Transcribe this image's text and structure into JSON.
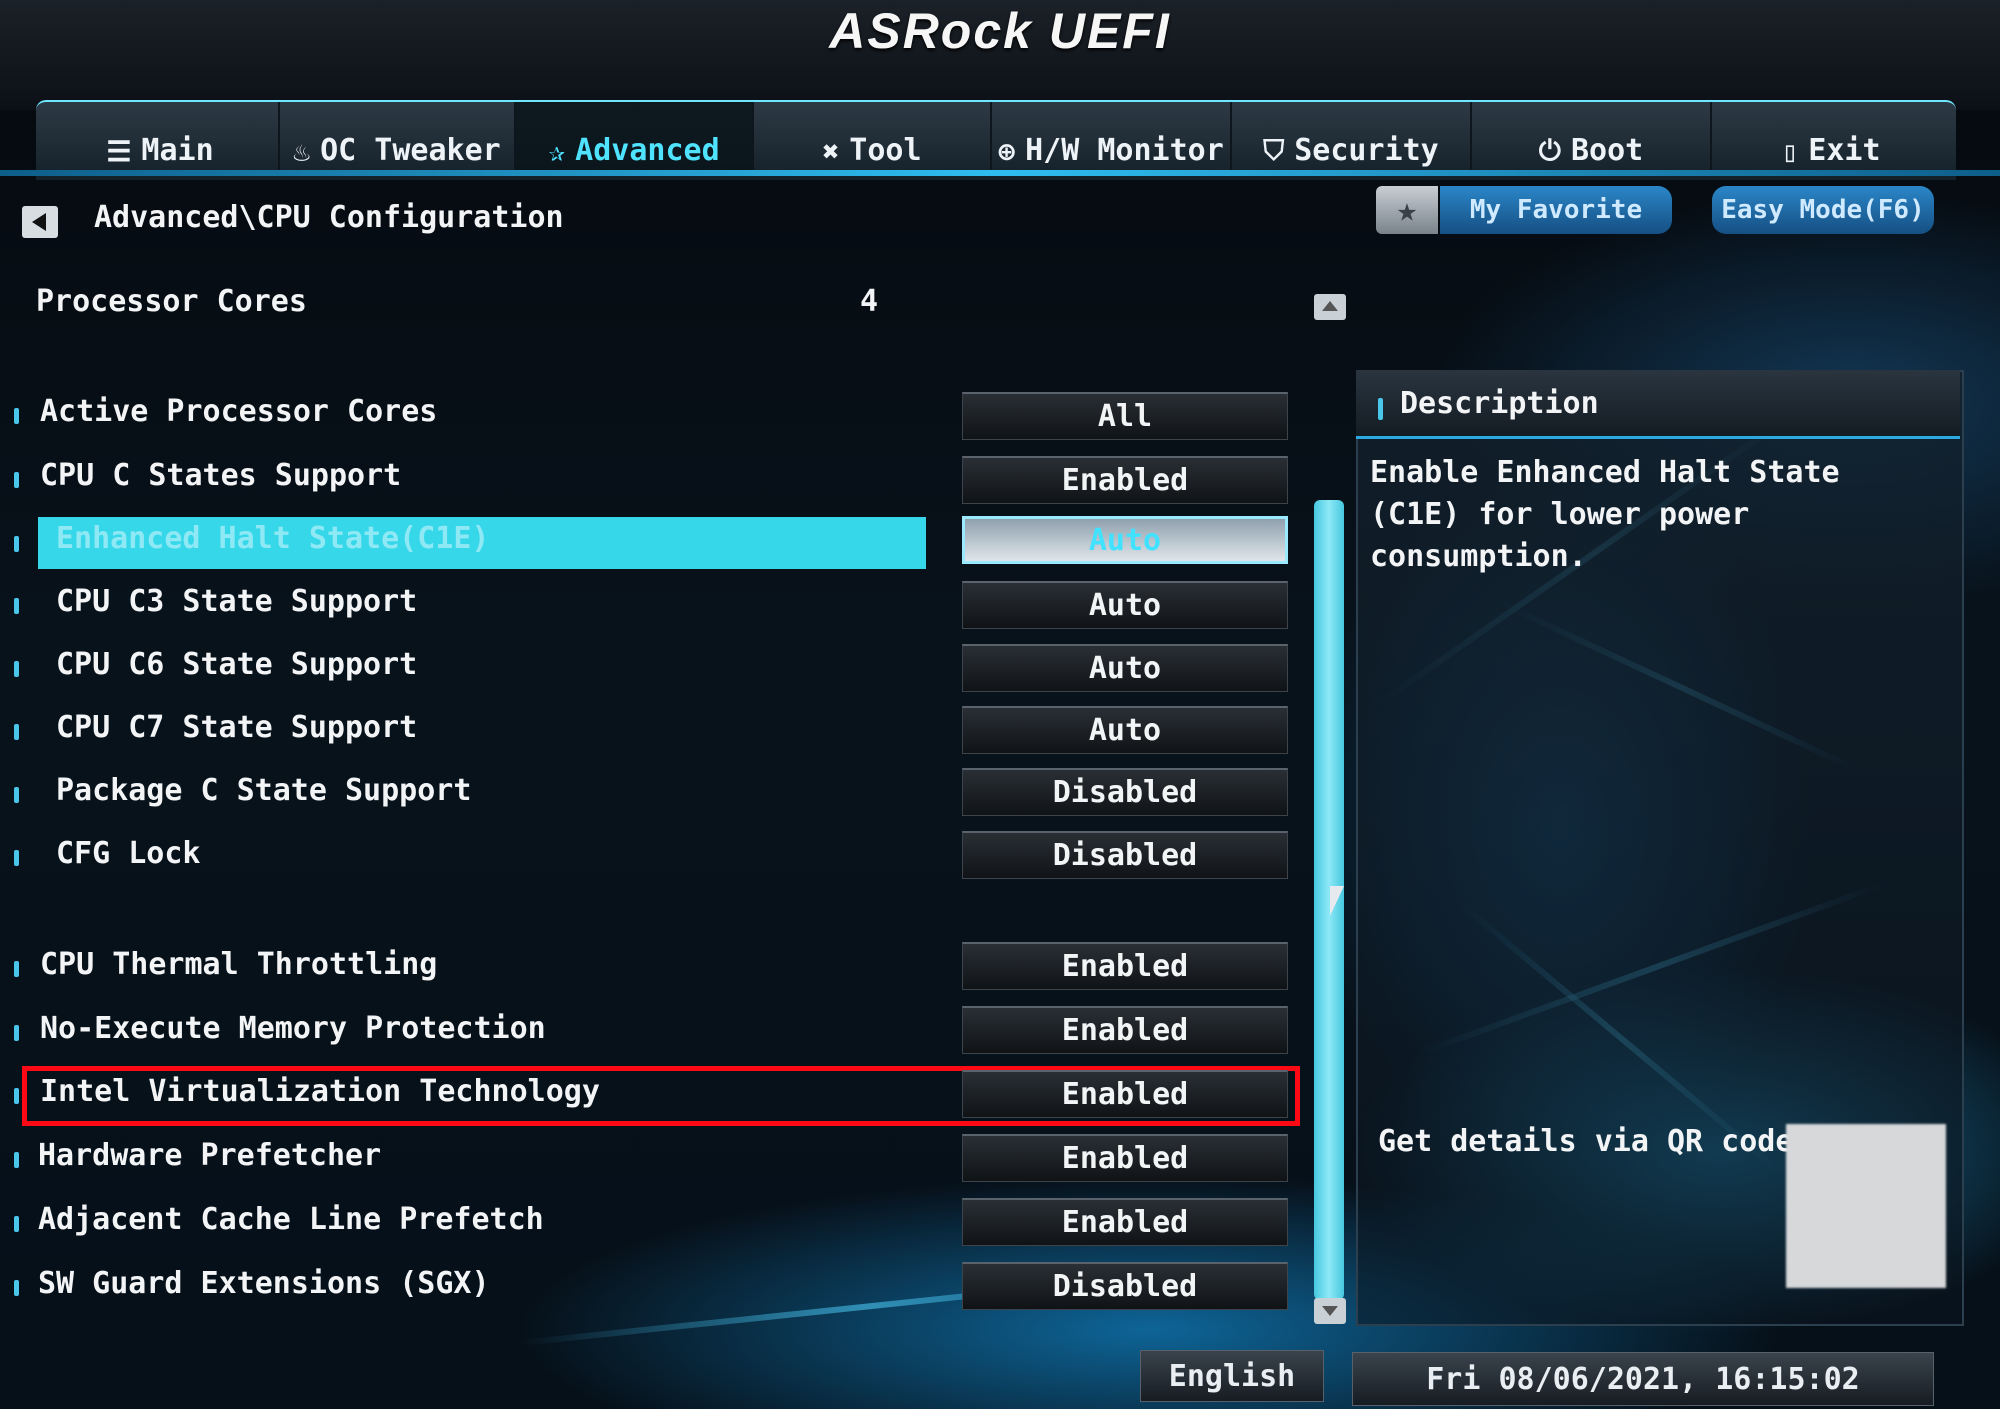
{
  "header": {
    "logo": "ASRock UEFI"
  },
  "tabs": [
    {
      "label": "Main",
      "icon": "list-icon",
      "glyph": "☰"
    },
    {
      "label": "OC Tweaker",
      "icon": "rocket-icon",
      "glyph": "♨"
    },
    {
      "label": "Advanced",
      "icon": "star-icon",
      "glyph": "✰"
    },
    {
      "label": "Tool",
      "icon": "tools-icon",
      "glyph": "✖"
    },
    {
      "label": "H/W Monitor",
      "icon": "monitor-icon",
      "glyph": "⊕"
    },
    {
      "label": "Security",
      "icon": "shield-icon",
      "glyph": "⛉"
    },
    {
      "label": "Boot",
      "icon": "power-icon",
      "glyph": "⏻"
    },
    {
      "label": "Exit",
      "icon": "exit-icon",
      "glyph": "▯"
    }
  ],
  "active_tab": "Advanced",
  "breadcrumb": "Advanced\\CPU Configuration",
  "favorites": {
    "star": "★",
    "my_favorite": "My Favorite",
    "easy_mode": "Easy Mode(F6)"
  },
  "processor_cores": {
    "label": "Processor Cores",
    "value": "4"
  },
  "settings": [
    {
      "label": "Active Processor Cores",
      "value": "All"
    },
    {
      "label": "CPU C States Support",
      "value": "Enabled"
    },
    {
      "label": "Enhanced Halt State(C1E)",
      "value": "Auto",
      "selected": true
    },
    {
      "label": "CPU C3 State Support",
      "value": "Auto"
    },
    {
      "label": "CPU C6 State Support",
      "value": "Auto"
    },
    {
      "label": "CPU C7 State Support",
      "value": "Auto"
    },
    {
      "label": "Package C State Support",
      "value": "Disabled"
    },
    {
      "label": "CFG Lock",
      "value": "Disabled"
    },
    {
      "label": "CPU Thermal Throttling",
      "value": "Enabled"
    },
    {
      "label": "No-Execute Memory Protection",
      "value": "Enabled"
    },
    {
      "label": "Intel Virtualization Technology",
      "value": "Enabled",
      "highlighted": true
    },
    {
      "label": "Hardware Prefetcher",
      "value": "Enabled"
    },
    {
      "label": "Adjacent Cache Line Prefetch",
      "value": "Enabled"
    },
    {
      "label": "SW Guard Extensions (SGX)",
      "value": "Disabled"
    }
  ],
  "description": {
    "title": "Description",
    "text": "Enable Enhanced Halt State (C1E) for lower power consumption.",
    "qr_label": "Get details via QR code"
  },
  "footer": {
    "language": "English",
    "datetime": "Fri 08/06/2021, 16:15:02"
  },
  "colors": {
    "accent": "#37d7ea",
    "highlight_box": "#ff0a14",
    "text": "#f2f4f6"
  }
}
